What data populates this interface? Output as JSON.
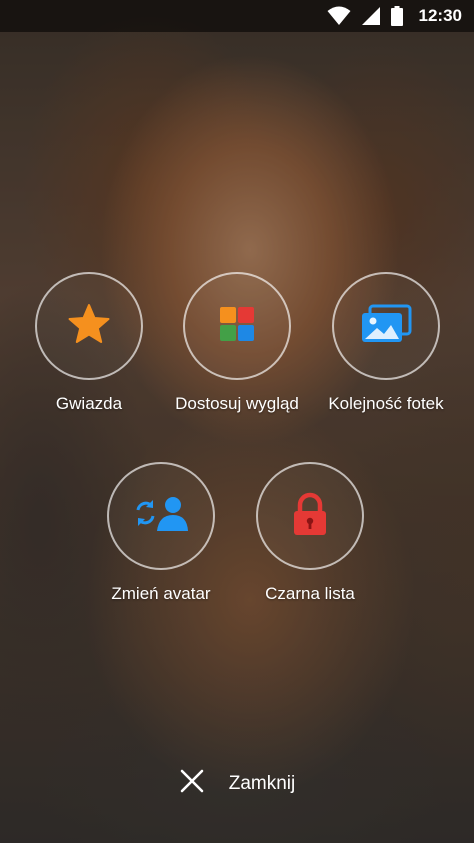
{
  "status_bar": {
    "time": "12:30",
    "icons": [
      "wifi-icon",
      "cell-signal-icon",
      "battery-icon"
    ]
  },
  "actions": [
    {
      "label": "Gwiazda",
      "icon": "star-icon",
      "color": "#F5901E"
    },
    {
      "label": "Dostosuj wygląd",
      "icon": "tiles-icon",
      "colors": [
        "#F5901E",
        "#E53935",
        "#43A047",
        "#1E88E5"
      ]
    },
    {
      "label": "Kolejność fotek",
      "icon": "photos-icon",
      "color": "#2196F3"
    },
    {
      "label": "Zmień avatar",
      "icon": "change-avatar-icon",
      "color": "#2196F3"
    },
    {
      "label": "Czarna lista",
      "icon": "lock-icon",
      "color": "#E53935"
    }
  ],
  "close": {
    "label": "Zamknij",
    "icon": "close-icon"
  }
}
